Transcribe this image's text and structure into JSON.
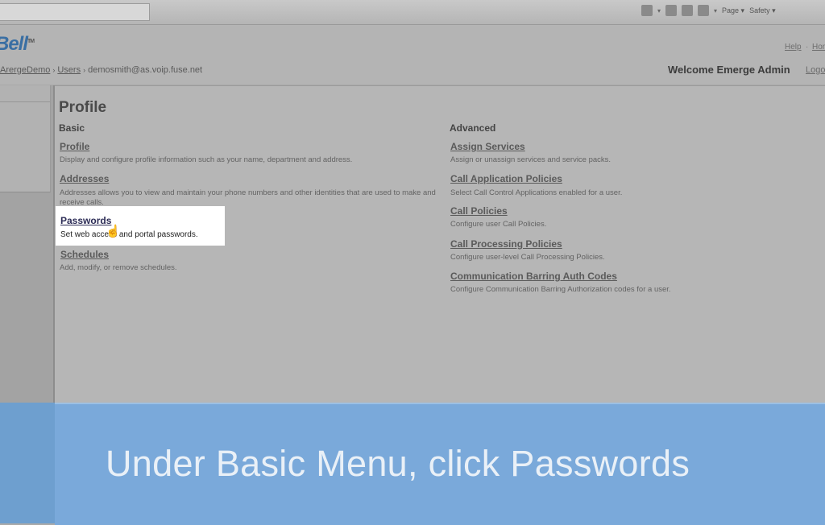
{
  "browser": {
    "toolbar_items": [
      "Page ▾",
      "Safety ▾"
    ]
  },
  "header": {
    "logo": "Bell",
    "logo_tm": "TM",
    "help": "Help",
    "home": "Hom",
    "breadcrumb": [
      "ArergeDemo",
      "Users",
      "demosmith@as.voip.fuse.net"
    ],
    "welcome": "Welcome Emerge Admin",
    "logout": "Logo"
  },
  "page": {
    "title": "Profile",
    "basic_heading": "Basic",
    "advanced_heading": "Advanced",
    "basic_items": [
      {
        "label": "Profile",
        "desc": "Display and configure profile information such as your name, department and address."
      },
      {
        "label": "Addresses",
        "desc": "Addresses allows you to view and maintain your phone numbers and other identities that are used to make and receive calls."
      },
      {
        "label": "Passwords",
        "desc": "Set web access and portal passwords."
      },
      {
        "label": "Schedules",
        "desc": "Add, modify, or remove schedules."
      }
    ],
    "advanced_items": [
      {
        "label": "Assign Services",
        "desc": "Assign or unassign services and service packs."
      },
      {
        "label": "Call Application Policies",
        "desc": "Select Call Control Applications enabled for a user."
      },
      {
        "label": "Call Policies",
        "desc": "Configure user Call Policies."
      },
      {
        "label": "Call Processing Policies",
        "desc": "Configure user-level Call Processing Policies."
      },
      {
        "label": "Communication Barring Auth Codes",
        "desc": "Configure Communication Barring Authorization codes for a user."
      }
    ]
  },
  "caption": "Under Basic Menu, click Passwords",
  "colors": {
    "banner": "#7aa9da",
    "logo": "#3a6fa3"
  }
}
